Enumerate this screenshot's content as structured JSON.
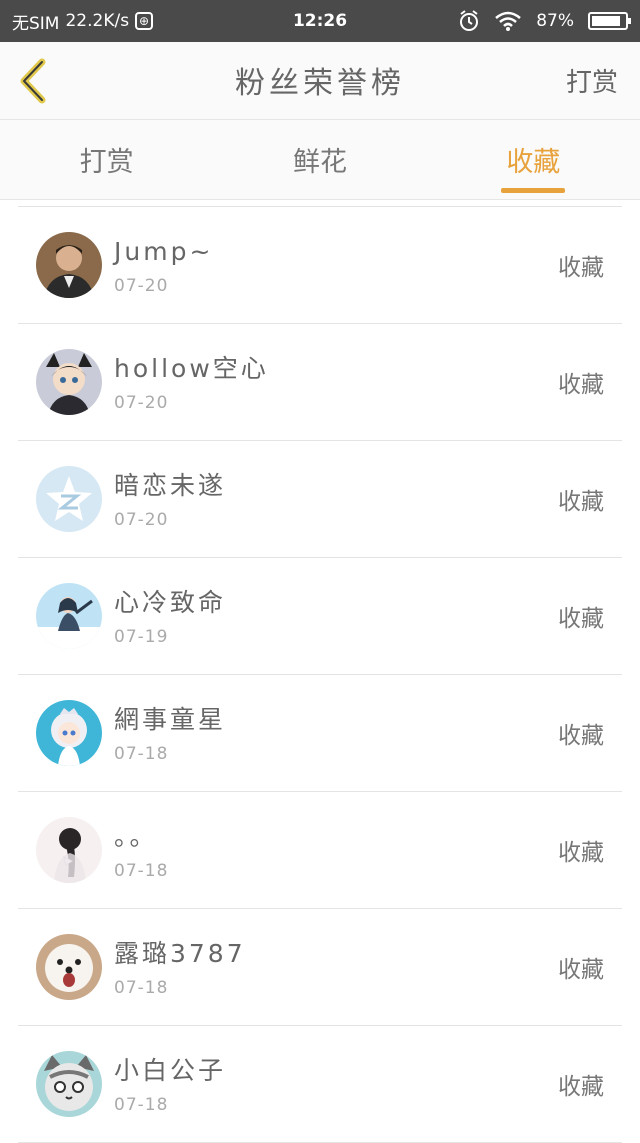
{
  "status_bar": {
    "carrier": "无SIM",
    "speed": "22.2K/s",
    "time": "12:26",
    "battery": "87%",
    "battery_level": 0.87
  },
  "navbar": {
    "title": "粉丝荣誉榜",
    "right_action": "打赏"
  },
  "tabs": [
    {
      "label": "打赏",
      "active": false
    },
    {
      "label": "鲜花",
      "active": false
    },
    {
      "label": "收藏",
      "active": true
    }
  ],
  "colors": {
    "accent": "#e8a23c",
    "status_bar_bg": "#4a4a4a"
  },
  "fans": [
    {
      "name": "Jump~",
      "date": "07-20",
      "action": "收藏",
      "avatar_icon": "man-portrait-avatar"
    },
    {
      "name": "hollow空心",
      "date": "07-20",
      "action": "收藏",
      "avatar_icon": "anime-cat-girl-avatar"
    },
    {
      "name": "暗恋未遂",
      "date": "07-20",
      "action": "收藏",
      "avatar_icon": "qzone-default-avatar"
    },
    {
      "name": "心冷致命",
      "date": "07-19",
      "action": "收藏",
      "avatar_icon": "anime-figure-avatar"
    },
    {
      "name": "網事童星",
      "date": "07-18",
      "action": "收藏",
      "avatar_icon": "anime-chibi-avatar"
    },
    {
      "name": "。。",
      "date": "07-18",
      "action": "收藏",
      "avatar_icon": "girl-back-avatar"
    },
    {
      "name": "露璐3787",
      "date": "07-18",
      "action": "收藏",
      "avatar_icon": "puppy-avatar"
    },
    {
      "name": "小白公子",
      "date": "07-18",
      "action": "收藏",
      "avatar_icon": "cartoon-cat-avatar"
    }
  ]
}
